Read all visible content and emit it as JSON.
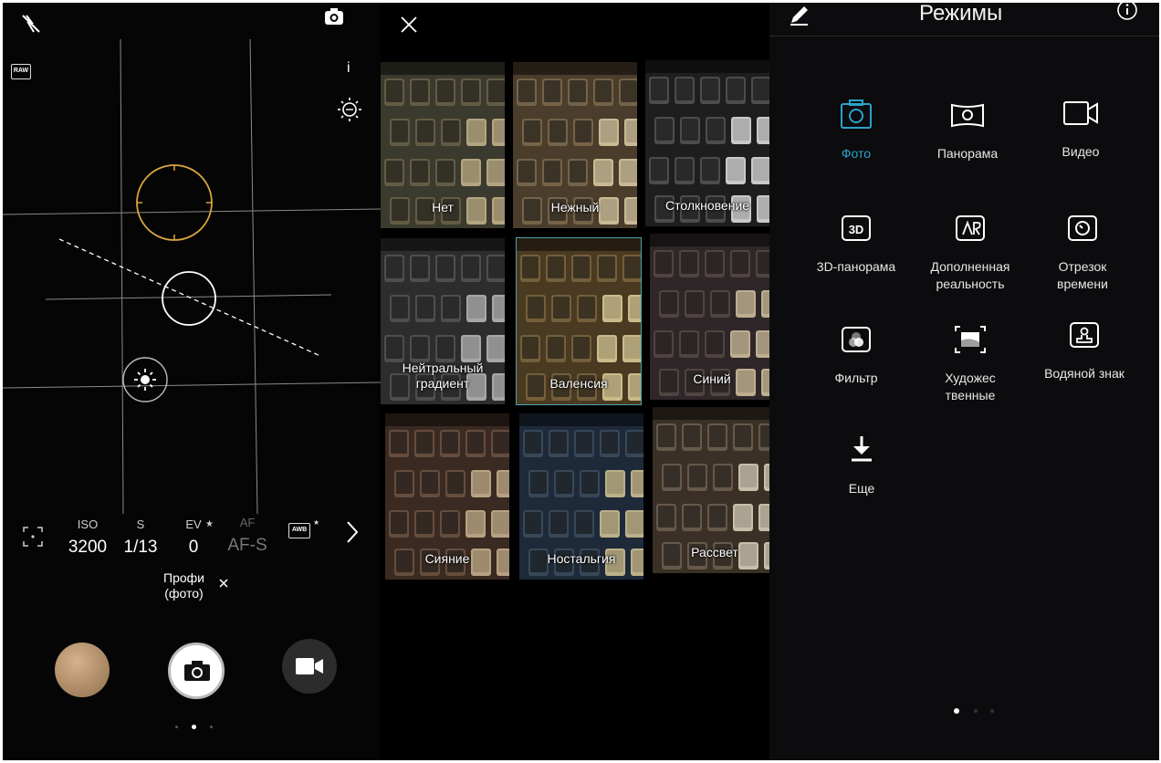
{
  "camera": {
    "raw_badge": "RAW",
    "info_label": "i",
    "params": [
      {
        "label": "ISO",
        "value": "3200"
      },
      {
        "label": "S",
        "value": "1/13"
      },
      {
        "label": "EV",
        "value": "0"
      },
      {
        "label": "AF",
        "value": "AF-S"
      }
    ],
    "awb_label": "AWB",
    "mode_name": "Профи\n(фото)",
    "mode_line1": "Профи",
    "mode_line2": "(фото)"
  },
  "filters": {
    "items": [
      {
        "name": "Нет"
      },
      {
        "name": "Нежный"
      },
      {
        "name": "Столкновение"
      },
      {
        "name": "Нейтральный\nградиент",
        "line1": "Нейтральный",
        "line2": "градиент"
      },
      {
        "name": "Валенсия",
        "selected": true
      },
      {
        "name": "Синий"
      },
      {
        "name": "Сияние"
      },
      {
        "name": "Ностальгия"
      },
      {
        "name": "Рассвет"
      }
    ]
  },
  "modes": {
    "title": "Режимы",
    "items": [
      {
        "label": "Фото",
        "icon": "camera-icon",
        "active": true
      },
      {
        "label": "Панорама",
        "icon": "panorama-icon"
      },
      {
        "label": "Видео",
        "icon": "video-icon"
      },
      {
        "label": "3D-панорама",
        "icon": "3d-panorama-icon"
      },
      {
        "label": "Дополненная реальность",
        "l1": "Дополненная",
        "l2": "реальность",
        "icon": "ar-icon"
      },
      {
        "label": "Отрезок времени",
        "l1": "Отрезок",
        "l2": "времени",
        "icon": "timelapse-icon"
      },
      {
        "label": "Фильтр",
        "icon": "filter-icon"
      },
      {
        "label": "Художественные",
        "l1": "Художес",
        "l2": "твенные",
        "icon": "artistic-icon"
      },
      {
        "label": "Водяной знак",
        "icon": "watermark-icon"
      },
      {
        "label": "Еще",
        "icon": "download-icon"
      }
    ],
    "accent": "#2aa3c9"
  },
  "colors": {
    "focus_ring": "#d9a53b",
    "selected_outline": "#4aa3a8"
  }
}
